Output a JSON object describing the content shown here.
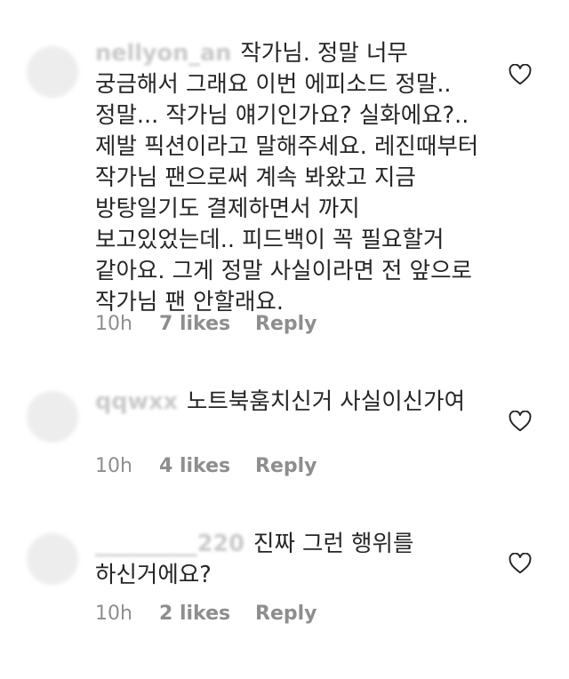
{
  "comments": [
    {
      "username": "nellyon_an",
      "text": "작가님. 정말 너무 궁금해서 그래요 이번 에피소드 정말..정말... 작가님 얘기인가요? 실화에요?.. 제발 픽션이라고 말해주세요. 레진때부터 작가님 팬으로써 계속 봐왔고 지금 방탕일기도 결제하면서 까지 보고있었는데.. 피드백이 꼭 필요할거 같아요. 그게 정말 사실이라면 전 앞으로 작가님 팬 안할래요.",
      "time": "10h",
      "likes": "7 likes",
      "reply": "Reply",
      "liked": false
    },
    {
      "username": "qqwxx",
      "text": "노트북훔치신거 사실이신가여",
      "time": "10h",
      "likes": "4 likes",
      "reply": "Reply",
      "liked": false
    },
    {
      "username": "_________220",
      "text": "진짜 그런 행위를 하신거에요?",
      "time": "10h",
      "likes": "2 likes",
      "reply": "Reply",
      "liked": false
    }
  ],
  "icons": {
    "like": "heart-outline-icon"
  },
  "colors": {
    "text": "#262626",
    "meta": "#8e8e8e",
    "icon": "#262626"
  }
}
